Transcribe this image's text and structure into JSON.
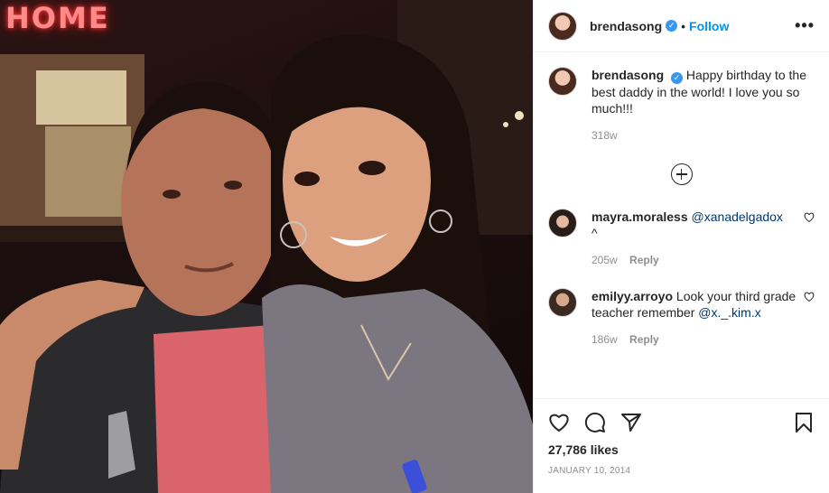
{
  "photo": {
    "sign_text": "HOME",
    "alt_subject": "photo"
  },
  "header": {
    "username": "brendasong",
    "verified_glyph": "✓",
    "separator": "•",
    "follow_label": "Follow",
    "more_glyph": "•••"
  },
  "caption": {
    "username": "brendasong",
    "verified_glyph": "✓",
    "text": "Happy birthday to the best daddy in the world! I love you so much!!!",
    "time": "318w"
  },
  "load_more_icon": "plus-circle-icon",
  "comments": [
    {
      "username": "mayra.moraless",
      "mention": "@xanadelgadox",
      "text": "^",
      "time": "205w",
      "reply_label": "Reply"
    },
    {
      "username": "emilyy.arroyo",
      "text": "Look your third grade teacher remember",
      "mention": "@x._.kim.x",
      "time": "186w",
      "reply_label": "Reply"
    }
  ],
  "actions": {
    "icons": [
      "heart-icon",
      "comment-icon",
      "share-icon",
      "bookmark-icon"
    ],
    "likes": "27,786 likes",
    "date": "January 10, 2014"
  },
  "colors": {
    "link": "#0095f6",
    "mention": "#00376b",
    "verified": "#3897f0",
    "muted": "#8e8e8e",
    "text": "#262626",
    "divider": "#efefef"
  }
}
